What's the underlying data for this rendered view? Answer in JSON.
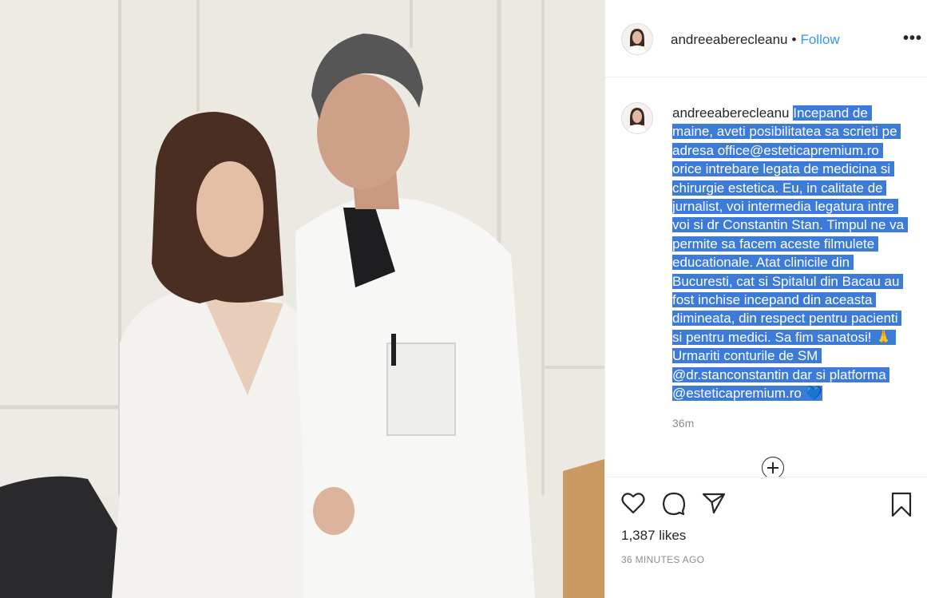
{
  "header": {
    "username": "andreeaberecleanu",
    "separator": "•",
    "follow_label": "Follow",
    "more_label": "•••"
  },
  "caption": {
    "username": "andreeaberecleanu",
    "text": "Incepand de maine, aveti posibilitatea sa scrieti pe adresa office@esteticapremium.ro orice intrebare legata de medicina si chirurgie estetica. Eu, in calitate de jurnalist, voi intermedia legatura intre voi si dr Constantin Stan. Timpul ne va permite sa facem aceste filmulete educationale. Atat clinicile din Bucuresti, cat si Spitalul din Bacau au fost inchise incepand din aceasta dimineata, din respect pentru pacienti si pentru medici. Sa fim sanatosi! 🙏 Urmariti conturile de SM @dr.stanconstantin dar si platforma @esteticapremium.ro 💙",
    "time_relative": "36m"
  },
  "actions": {
    "icons": [
      "heart-icon",
      "comment-icon",
      "share-icon",
      "bookmark-icon"
    ]
  },
  "stats": {
    "likes": "1,387 likes",
    "time_absolute": "36 MINUTES AGO"
  },
  "colors": {
    "follow": "#3897f0",
    "selection_highlight": "#3d7bd9",
    "text": "#262626",
    "muted": "#8e8e8e"
  }
}
